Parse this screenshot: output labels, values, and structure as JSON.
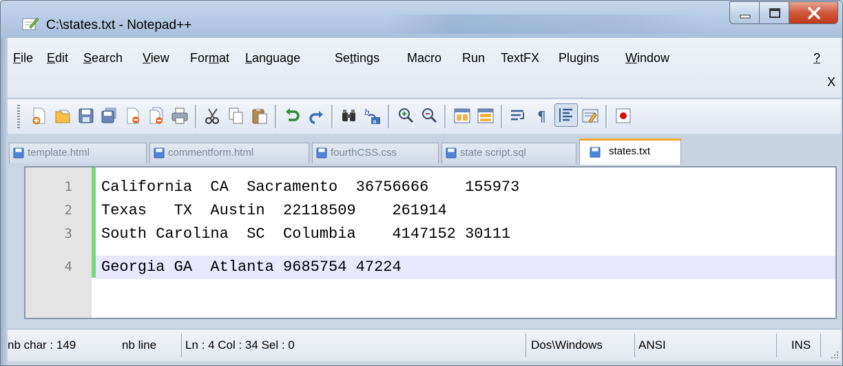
{
  "window": {
    "title": "C:\\states.txt - Notepad++"
  },
  "menu": {
    "items": [
      {
        "label": "File",
        "ul": "F",
        "rest": "ile"
      },
      {
        "label": "Edit",
        "ul": "E",
        "rest": "dit"
      },
      {
        "label": "Search",
        "ul": "S",
        "rest": "earch"
      },
      {
        "label": "View",
        "ul": "V",
        "rest": "iew"
      },
      {
        "label": "Format",
        "pre": "For",
        "ul": "m",
        "rest": "at"
      },
      {
        "label": "Language",
        "ul": "L",
        "rest": "anguage"
      },
      {
        "label": "Settings",
        "pre": "Se",
        "ul": "t",
        "rest": "tings"
      },
      {
        "label": "Macro"
      },
      {
        "label": "Run"
      },
      {
        "label": "TextFX"
      },
      {
        "label": "Plugins"
      },
      {
        "label": "Window",
        "ul": "W",
        "rest": "indow"
      },
      {
        "label": "?",
        "ul": "?",
        "rest": ""
      }
    ],
    "close_label": "X"
  },
  "toolbar": {
    "buttons": [
      "new-file-icon",
      "open-file-icon",
      "save-icon",
      "save-all-icon",
      "close-icon",
      "close-all-icon",
      "print-icon",
      "cut-icon",
      "copy-icon",
      "paste-icon",
      "undo-icon",
      "redo-icon",
      "find-icon",
      "replace-icon",
      "zoom-in-icon",
      "zoom-out-icon",
      "sync-vertical-icon",
      "sync-horizontal-icon",
      "word-wrap-icon",
      "show-all-chars-icon",
      "indent-guide-icon",
      "user-define-icon",
      "record-macro-icon"
    ]
  },
  "tabs": [
    {
      "label": "template.html",
      "active": false
    },
    {
      "label": "commentform.html",
      "active": false
    },
    {
      "label": "fourthCSS.css",
      "active": false
    },
    {
      "label": "state script.sql",
      "active": false
    },
    {
      "label": "states.txt",
      "active": true
    }
  ],
  "editor": {
    "lines": [
      {
        "num": "1",
        "text": "California  CA  Sacramento  36756666    155973"
      },
      {
        "num": "2",
        "text": "Texas   TX  Austin  22118509    261914"
      },
      {
        "num": "3",
        "text": "South Carolina  SC  Columbia    4147152 30111"
      },
      {
        "num": "4",
        "text": "Georgia GA  Atlanta 9685754 47224"
      }
    ],
    "current_line": 4
  },
  "status": {
    "nb_char": "nb char : 149",
    "nb_line": "nb line",
    "position": "Ln : 4    Col : 34    Sel : 0",
    "eol": "Dos\\Windows",
    "encoding": "ANSI",
    "mode": "INS"
  },
  "colors": {
    "active_tab_accent": "#f6a52d",
    "fold_margin": "#7ad67a",
    "current_line": "#e8e8ff",
    "close_button": "#d0583a"
  }
}
